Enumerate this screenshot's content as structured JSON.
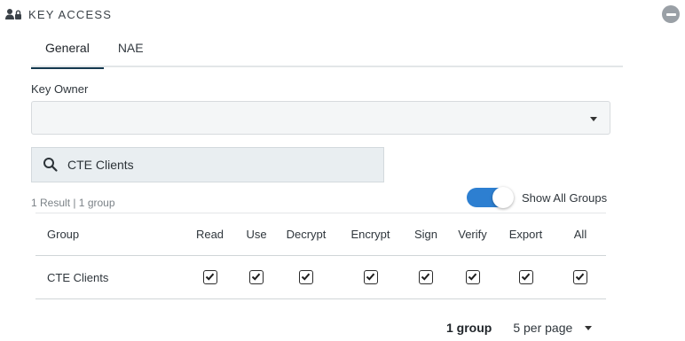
{
  "section": {
    "title": "KEY ACCESS",
    "header_icon": "user-lock-icon",
    "collapse_icon": "minus-circle-icon"
  },
  "tabs": [
    {
      "label": "General",
      "active": true
    },
    {
      "label": "NAE",
      "active": false
    }
  ],
  "key_owner": {
    "label": "Key Owner",
    "value": ""
  },
  "search": {
    "value": "CTE Clients",
    "icon": "search-icon"
  },
  "results": {
    "summary": "1 Result | 1 group"
  },
  "toggle": {
    "label": "Show All Groups",
    "on": true,
    "color": "#2d7fd1"
  },
  "table": {
    "columns": [
      "Group",
      "Read",
      "Use",
      "Decrypt",
      "Encrypt",
      "Sign",
      "Verify",
      "Export",
      "All"
    ],
    "rows": [
      {
        "group": "CTE Clients",
        "read": true,
        "use": true,
        "decrypt": true,
        "encrypt": true,
        "sign": true,
        "verify": true,
        "export": true,
        "all": true
      }
    ]
  },
  "pagination": {
    "count": "1 group",
    "per_page": "5 per page"
  }
}
